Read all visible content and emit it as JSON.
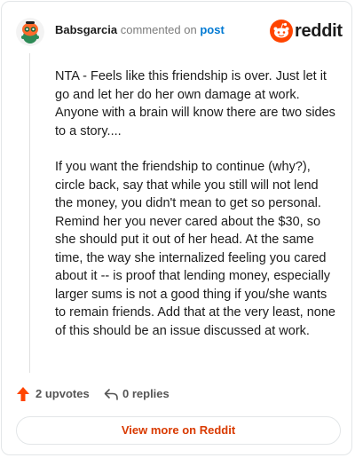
{
  "header": {
    "author": "Babsgarcia",
    "verb": "commented on",
    "post_link": "post",
    "logo_text": "reddit"
  },
  "comment": {
    "paragraphs": [
      "NTA - Feels like this friendship is over. Just let it go and let her do her own damage at work. Anyone with a brain will know there are two sides to a story....",
      "If you want the friendship to continue (why?), circle back, say that while you still will not lend the money, you didn't mean to get so personal. Remind her you never cared about the $30, so she should put it out of her head. At the same time, the way she internalized feeling you cared about it -- is proof that lending money, especially larger sums is not a good thing if you/she wants to remain friends. Add that at the very least, none of this should be an issue discussed at work."
    ]
  },
  "actions": {
    "upvotes_label": "2 upvotes",
    "replies_label": "0 replies"
  },
  "footer": {
    "view_more_label": "View more on Reddit"
  },
  "colors": {
    "brand": "#ff4500",
    "link": "#0079d3",
    "view_more": "#d93a00",
    "upvote_arrow": "#ff4500"
  },
  "icons": [
    "avatar-snoo",
    "reddit-logo-icon",
    "upvote-arrow-icon",
    "reply-arrow-icon"
  ]
}
